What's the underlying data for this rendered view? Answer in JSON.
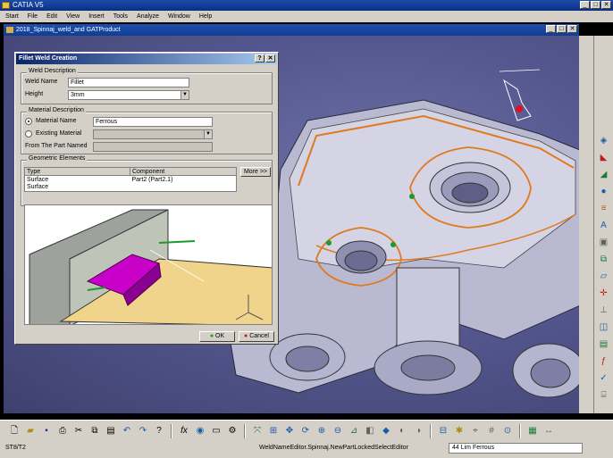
{
  "app": {
    "title": "CATIA V5",
    "minimize": "_",
    "maximize": "□",
    "close": "✕"
  },
  "menu": [
    "Start",
    "File",
    "Edit",
    "View",
    "Insert",
    "Tools",
    "Analyze",
    "Window",
    "Help"
  ],
  "document": {
    "title": "2018_Spinnaj_weld_and GATProduct",
    "minimize": "_",
    "maximize": "□",
    "close": "✕"
  },
  "dialog": {
    "title": "Fillet Weld Creation",
    "help": "?",
    "close": "✕",
    "weld_desc": {
      "group_label": "Weld Description",
      "weld_name_label": "Weld Name",
      "weld_name_value": "Fillet",
      "height_label": "Height",
      "height_value": "3mm"
    },
    "material_desc": {
      "group_label": "Material Description",
      "material_name_label": "Material Name",
      "material_name_value": "Ferrous",
      "existing_material_label": "Existing Material",
      "from_part_label": "From The Part Named"
    },
    "geometric": {
      "group_label": "Geometric Elements",
      "columns": [
        "Type",
        "Component"
      ],
      "rows": [
        {
          "type": "Surface",
          "component": "Part2 (Part2.1)"
        },
        {
          "type": "Surface",
          "component": ""
        }
      ],
      "more_button": "More >>"
    },
    "ok_button": "OK",
    "cancel_button": "Cancel"
  },
  "status": {
    "left": "ST8/T2",
    "center": "WeldNameEditor.Spinnaj.NewPartLockedSelectEditor",
    "input_value": "44 Lim Ferrous"
  },
  "colors": {
    "viewport": "#55588f",
    "part": "#cfcfe0",
    "weld": "#c800c8",
    "orange": "#e07a20"
  }
}
